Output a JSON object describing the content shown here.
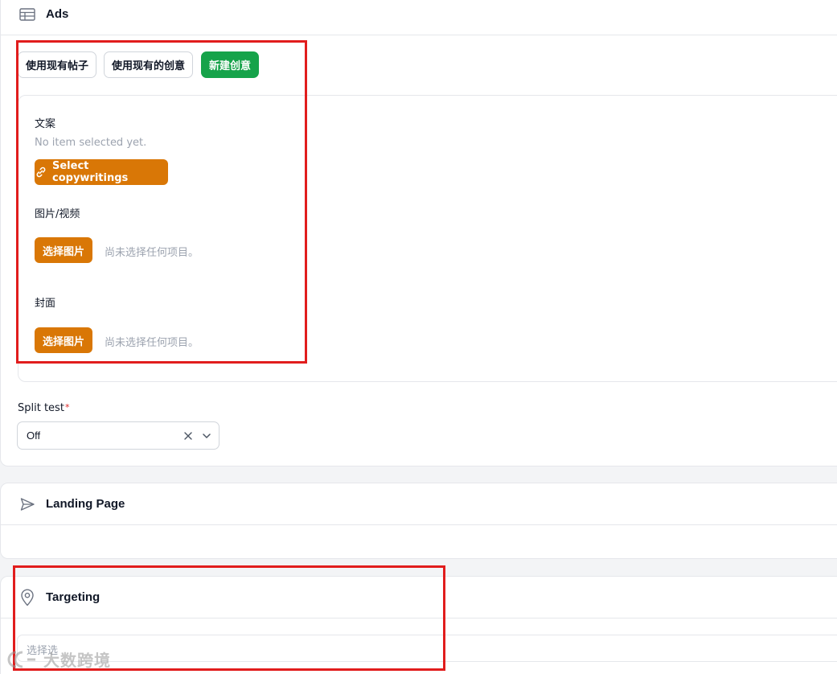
{
  "ads": {
    "title": "Ads",
    "icon": "table-icon",
    "tabs": [
      {
        "label": "使用现有帖子"
      },
      {
        "label": "使用现有的创意"
      },
      {
        "label": "新建创意"
      }
    ],
    "copy_label": "文案",
    "copy_empty": "No item selected yet.",
    "copy_button": "Select copywritings",
    "copy_button_icon": "link-icon",
    "media_label": "图片/视频",
    "media_button": "选择图片",
    "media_empty": "尚未选择任何项目。",
    "cover_label": "封面",
    "cover_button": "选择图片",
    "cover_empty": "尚未选择任何项目。",
    "split_test_label": "Split test",
    "split_test_required": "*",
    "split_test_value": "Off"
  },
  "landing": {
    "title": "Landing Page",
    "icon": "send-icon"
  },
  "targeting": {
    "title": "Targeting",
    "icon": "map-pin-icon",
    "input_placeholder": "选择选"
  },
  "watermark": {
    "text": "大数跨境"
  },
  "colors": {
    "accent_green": "#16a34a",
    "accent_orange": "#d97706",
    "highlight_red": "#e11d1d"
  }
}
